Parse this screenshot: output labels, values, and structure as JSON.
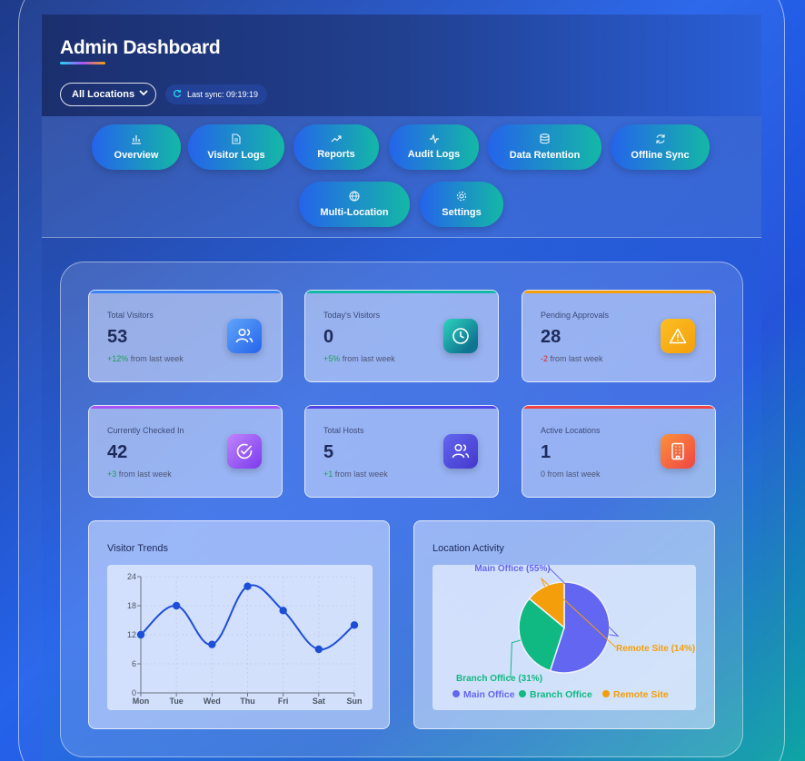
{
  "header": {
    "title": "Admin Dashboard",
    "location_select": "All Locations",
    "last_sync": "Last sync: 09:19:19"
  },
  "nav": [
    {
      "label": "Overview",
      "icon": "bar-chart-icon"
    },
    {
      "label": "Visitor Logs",
      "icon": "document-icon"
    },
    {
      "label": "Reports",
      "icon": "trending-up-icon"
    },
    {
      "label": "Audit Logs",
      "icon": "activity-icon"
    },
    {
      "label": "Data Retention",
      "icon": "database-icon"
    },
    {
      "label": "Offline Sync",
      "icon": "refresh-icon"
    },
    {
      "label": "Multi-Location",
      "icon": "globe-icon"
    },
    {
      "label": "Settings",
      "icon": "gear-icon"
    }
  ],
  "stats": [
    {
      "label": "Total Visitors",
      "value": "53",
      "delta": "+12%",
      "delta_suffix": " from last week",
      "delta_type": "pos",
      "icon": "users-icon",
      "color": "#3b82f6"
    },
    {
      "label": "Today's Visitors",
      "value": "0",
      "delta": "+5%",
      "delta_suffix": " from last week",
      "delta_type": "pos",
      "icon": "clock-icon",
      "color": "#14b8a6"
    },
    {
      "label": "Pending Approvals",
      "value": "28",
      "delta": "-2",
      "delta_suffix": " from last week",
      "delta_type": "neg",
      "icon": "alert-icon",
      "color": "#f59e0b"
    },
    {
      "label": "Currently Checked In",
      "value": "42",
      "delta": "+3",
      "delta_suffix": " from last week",
      "delta_type": "pos",
      "icon": "check-circle-icon",
      "color": "#a855f7"
    },
    {
      "label": "Total Hosts",
      "value": "5",
      "delta": "+1",
      "delta_suffix": " from last week",
      "delta_type": "pos",
      "icon": "users-icon",
      "color": "#4f46e5"
    },
    {
      "label": "Active Locations",
      "value": "1",
      "delta": "0",
      "delta_suffix": " from last week",
      "delta_type": "neutral",
      "icon": "building-icon",
      "color": "#f97316"
    }
  ],
  "visitor_trends": {
    "title": "Visitor Trends"
  },
  "location_activity": {
    "title": "Location Activity"
  },
  "chart_data": [
    {
      "type": "line",
      "title": "Visitor Trends",
      "categories": [
        "Mon",
        "Tue",
        "Wed",
        "Thu",
        "Fri",
        "Sat",
        "Sun"
      ],
      "values": [
        12,
        18,
        10,
        22,
        17,
        9,
        14
      ],
      "yticks": [
        0,
        6,
        12,
        18,
        24
      ],
      "ylim": [
        0,
        24
      ],
      "color": "#1d4ed8"
    },
    {
      "type": "pie",
      "title": "Location Activity",
      "labels": [
        "Main Office",
        "Branch Office",
        "Remote Site"
      ],
      "values": [
        55,
        31,
        14
      ],
      "slice_labels": [
        "Main Office (55%)",
        "Branch Office (31%)",
        "Remote Site (14%)"
      ],
      "colors": [
        "#6366f1",
        "#10b981",
        "#f59e0b"
      ],
      "legend": "bottom"
    }
  ]
}
